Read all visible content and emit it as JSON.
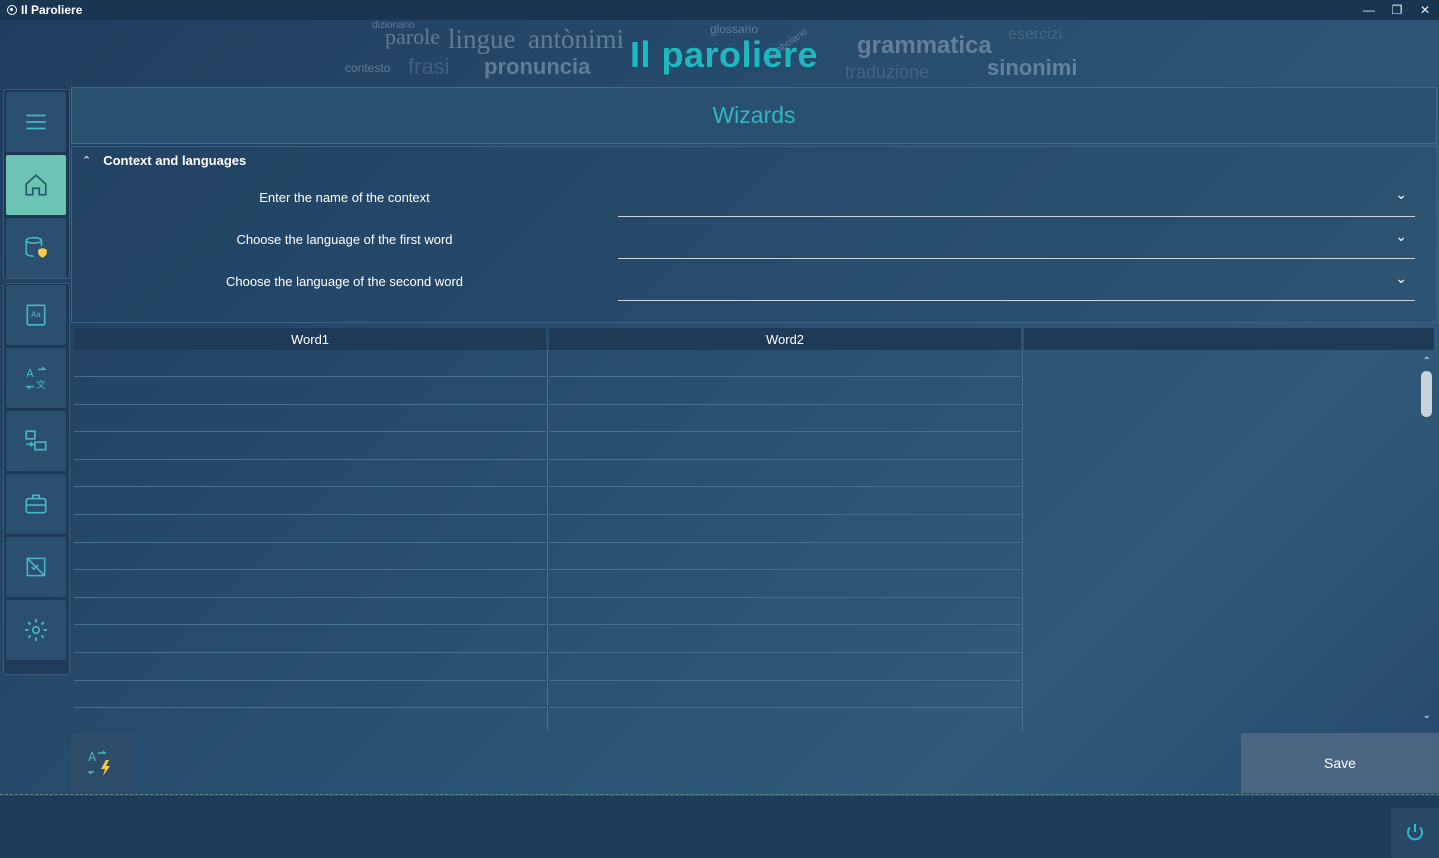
{
  "window": {
    "title": "Il Paroliere",
    "controls": [
      "minimize-icon",
      "restore-icon",
      "close-icon"
    ]
  },
  "banner": {
    "brand": "Il paroliere",
    "words": [
      "dizionario",
      "parole",
      "lingue",
      "antònimi",
      "glossario",
      "grammatica",
      "esercizi",
      "contesto",
      "frasi",
      "pronuncia",
      "traduzione",
      "sinonimi",
      "vocabolario"
    ]
  },
  "sidebar": {
    "items": [
      {
        "icon": "menu-icon",
        "active": false
      },
      {
        "icon": "home-icon",
        "active": true
      },
      {
        "icon": "database-shield-icon",
        "active": false
      },
      {
        "icon": "dictionary-icon",
        "active": false
      },
      {
        "icon": "translate-icon",
        "active": false
      },
      {
        "icon": "transfer-icon",
        "active": false
      },
      {
        "icon": "briefcase-icon",
        "active": false
      },
      {
        "icon": "checklist-icon",
        "active": false
      },
      {
        "icon": "settings-icon",
        "active": false
      }
    ]
  },
  "main": {
    "title": "Wizards",
    "expander": {
      "title": "Context and languages",
      "expanded": true,
      "fields": [
        {
          "label": "Enter the name of the context",
          "value": ""
        },
        {
          "label": "Choose the language of the first word",
          "value": ""
        },
        {
          "label": "Choose the language of the second word",
          "value": ""
        }
      ]
    },
    "grid": {
      "columns": [
        "Word1",
        "Word2",
        ""
      ],
      "row_count": 14
    },
    "save_label": "Save"
  },
  "colors": {
    "accent": "#31b6c2",
    "active_nav": "#6ec4b2",
    "brand": "#1fb8c0"
  }
}
